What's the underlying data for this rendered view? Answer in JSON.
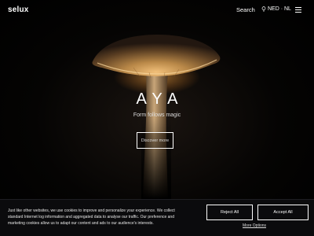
{
  "header": {
    "logo": "selux",
    "search_label": "Search",
    "lang_label": "NED · NL",
    "lang_icon": "pin-icon",
    "menu_icon": "hamburger-icon"
  },
  "hero": {
    "title": "AYA",
    "subtitle": "Form follows magic",
    "cta_label": "Discover more"
  },
  "cookie_banner": {
    "text": "Just like other websites, we use cookies to improve and personalize your experience. We collect standard Internet log information and aggregated data to analyse our traffic. Our preference and marketing cookies allow us to adapt our content and ads to our audience's interests.",
    "reject_label": "Reject All",
    "accept_label": "Accept All",
    "more_options_label": "More Options"
  }
}
